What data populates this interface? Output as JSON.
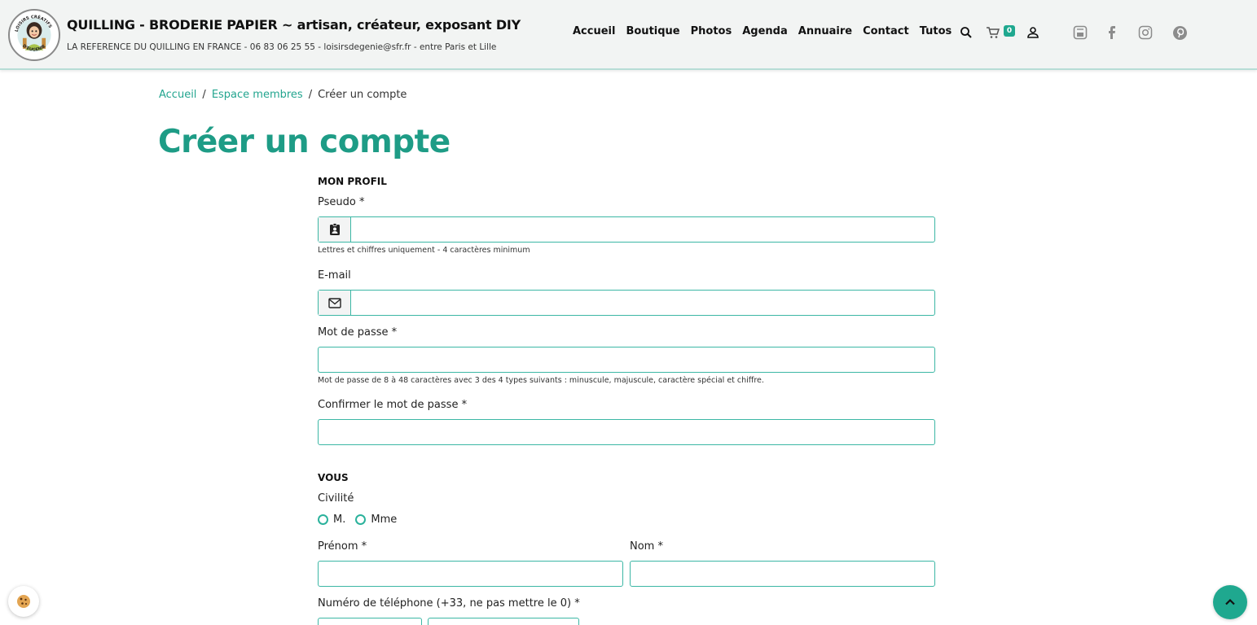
{
  "header": {
    "logo_text": "LOISIRS CRÉATIFS D'EUGENIE",
    "title": "QUILLING - BRODERIE PAPIER ~ artisan, créateur, exposant DIY",
    "subtitle": "LA REFERENCE DU QUILLING EN FRANCE - 06 83 06 25 55 - loisirsdegenie@sfr.fr - entre Paris et Lille",
    "nav": [
      "Accueil",
      "Boutique",
      "Photos",
      "Agenda",
      "Annuaire",
      "Contact",
      "Tutos"
    ],
    "cart_count": "0",
    "icons": [
      "search-icon",
      "cart-icon",
      "user-icon",
      "youtube-icon",
      "facebook-icon",
      "instagram-icon",
      "pinterest-icon"
    ],
    "social_color": "#8c8c8c"
  },
  "breadcrumb": {
    "items": [
      "Accueil",
      "Espace membres"
    ],
    "current": "Créer un compte",
    "separator": "/"
  },
  "page_title": "Créer un compte",
  "form": {
    "profile_section": "MON PROFIL",
    "pseudo_label": "Pseudo *",
    "pseudo_hint": "Lettres et chiffres uniquement - 4 caractères minimum",
    "pseudo_value": "",
    "email_label": "E-mail",
    "email_value": "",
    "password_label": "Mot de passe *",
    "password_hint": "Mot de passe de 8 à 48 caractères avec 3 des 4 types suivants : minuscule, majuscule, caractère spécial et chiffre.",
    "password_value": "",
    "confirm_label": "Confirmer le mot de passe *",
    "confirm_value": "",
    "you_section": "VOUS",
    "civility_label": "Civilité",
    "civility_options": [
      "M.",
      "Mme"
    ],
    "firstname_label": "Prénom *",
    "firstname_value": "",
    "lastname_label": "Nom *",
    "lastname_value": "",
    "phone_label": "Numéro de téléphone (+33, ne pas mettre le 0) *"
  },
  "colors": {
    "accent": "#1e9c86",
    "input_border": "#3cb7a5",
    "header_bg": "#f2f4f3"
  }
}
